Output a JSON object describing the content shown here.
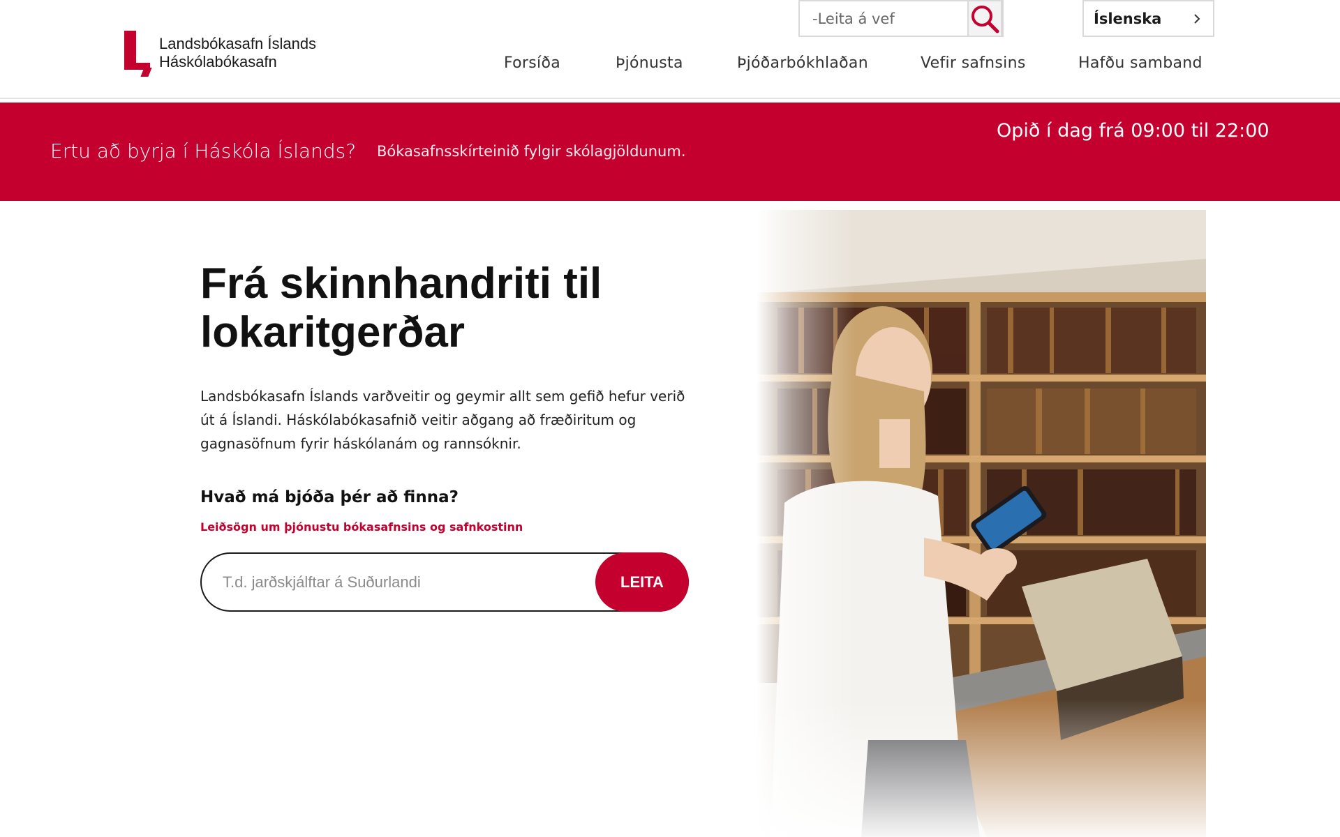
{
  "header": {
    "logo_line1": "Landsbókasafn Íslands",
    "logo_line2": "Háskólabókasafn",
    "search_placeholder": "-Leita á vef",
    "language": "Íslenska",
    "nav": [
      "Forsíða",
      "Þjónusta",
      "Þjóðarbókhlaðan",
      "Vefir safnsins",
      "Hafðu samband"
    ]
  },
  "banner": {
    "question": "Ertu að byrja í Háskóla Íslands?",
    "subtext": "Bókasafnsskírteinið fylgir skólagjöldunum.",
    "hours": "Opið í dag frá 09:00 til 22:00"
  },
  "hero": {
    "title": "Frá skinnhandriti til lokaritgerðar",
    "text": "Landsbókasafn Íslands varðveitir og geymir allt sem gefið hefur verið út á Íslandi. Háskólabókasafnið veitir aðgang að fræðiritum og gagnasöfnum fyrir háskólanám og rannsóknir.",
    "question": "Hvað má bjóða þér að finna?",
    "guide_link": "Leiðsögn um þjónustu bókasafnsins og safnkostinn",
    "search_placeholder": "T.d. jarðskjálftar á Suðurlandi",
    "search_button": "LEITA"
  },
  "colors": {
    "brand_red": "#c4002f",
    "text_dark": "#1a1a1a"
  },
  "icons": [
    "search-icon",
    "chevron-right-icon",
    "library-logo-icon"
  ]
}
